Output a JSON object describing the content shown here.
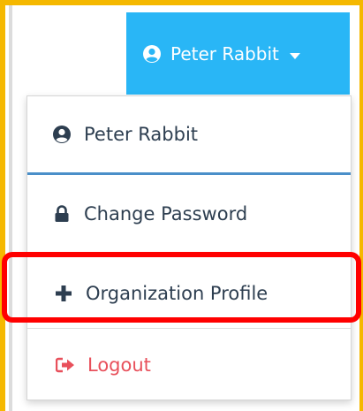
{
  "header": {
    "user_name": "Peter Rabbit",
    "user_icon": "user-circle-icon",
    "caret_icon": "caret-down-icon"
  },
  "menu": {
    "profile_label": "Peter Rabbit",
    "profile_icon": "user-circle-icon",
    "change_password_label": "Change Password",
    "change_password_icon": "lock-icon",
    "organization_profile_label": "Organization Profile",
    "organization_profile_icon": "plus-icon",
    "logout_label": "Logout",
    "logout_icon": "sign-out-icon"
  },
  "colors": {
    "toggle_bg": "#29b6f6",
    "menu_text": "#2d3e50",
    "logout_text": "#e8505b",
    "highlight": "#ff0000",
    "frame": "#f5b800"
  }
}
